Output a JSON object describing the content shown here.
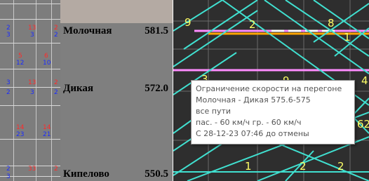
{
  "stations": [
    {
      "name": "Молочная",
      "km": "581.5"
    },
    {
      "name": "Дикая",
      "km": "572.0"
    },
    {
      "name": "Кипелово",
      "km": "550.5"
    }
  ],
  "grid": {
    "numbers": [
      {
        "text": "2",
        "color": "#1a2cff"
      },
      {
        "text": "3",
        "color": "#1a2cff"
      },
      {
        "text": "13",
        "color": "#ff2a2a"
      },
      {
        "text": "2",
        "color": "#ff2a2a"
      },
      {
        "text": "2",
        "color": "#1a2cff"
      },
      {
        "text": "3",
        "color": "#1a2cff"
      },
      {
        "text": "5",
        "color": "#ff2a2a"
      },
      {
        "text": "12",
        "color": "#1a2cff"
      },
      {
        "text": "6",
        "color": "#ff2a2a"
      },
      {
        "text": "10",
        "color": "#1a2cff"
      },
      {
        "text": "3",
        "color": "#1a2cff"
      },
      {
        "text": "2",
        "color": "#1a2cff"
      },
      {
        "text": "13",
        "color": "#ff2a2a"
      },
      {
        "text": "2",
        "color": "#ff2a2a"
      },
      {
        "text": "3",
        "color": "#1a2cff"
      },
      {
        "text": "2",
        "color": "#1a2cff"
      },
      {
        "text": "14",
        "color": "#ff2a2a"
      },
      {
        "text": "23",
        "color": "#1a2cff"
      },
      {
        "text": "14",
        "color": "#ff2a2a"
      },
      {
        "text": "21",
        "color": "#1a2cff"
      },
      {
        "text": "2",
        "color": "#1a2cff"
      },
      {
        "text": "3",
        "color": "#1a2cff"
      },
      {
        "text": "33",
        "color": "#ff2a2a"
      },
      {
        "text": "2",
        "color": "#ff2a2a"
      }
    ]
  },
  "schedule": {
    "train_labels": [
      "9",
      "2",
      "8",
      "3",
      "9",
      "4",
      "62",
      "1",
      "2",
      "2",
      "1"
    ]
  },
  "tooltip": {
    "lines": [
      "Ограничение скорости на перегоне",
      "Молочная - Дикая   575.6-575",
      "все пути",
      "пас. - 60 км/ч гр. - 60 км/ч",
      "С 28-12-23 07:46 до отмены"
    ]
  },
  "colors": {
    "grid_bg": "#7d7d7d",
    "stations_bg": "#7f7f7f",
    "schedule_bg": "#2e2e2e",
    "train_line": "#40e0d0",
    "restriction_pink": "#ff8cff",
    "restriction_orange": "#ffa500",
    "label_yellow": "#ffff66"
  }
}
